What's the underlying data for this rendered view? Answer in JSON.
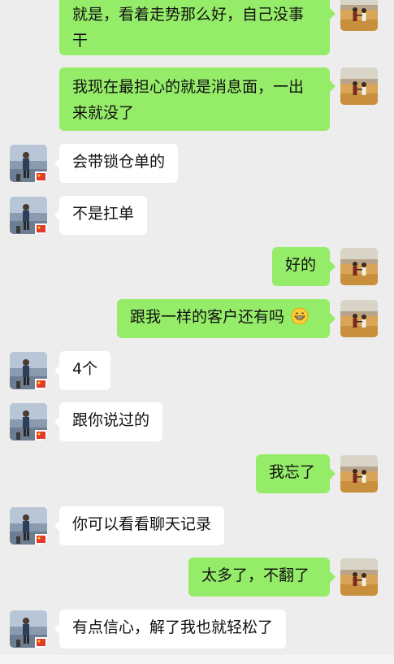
{
  "messages": [
    {
      "side": "right",
      "text": "就是，看着走势那么好，自己没事干"
    },
    {
      "side": "right",
      "text": "我现在最担心的就是消息面，一出来就没了"
    },
    {
      "side": "left",
      "text": "会带锁仓单的"
    },
    {
      "side": "left",
      "text": "不是扛单"
    },
    {
      "side": "right",
      "text": "好的"
    },
    {
      "side": "right",
      "text": "跟我一样的客户还有吗",
      "emoji": "grinning-face-emoji"
    },
    {
      "side": "left",
      "text": "4个"
    },
    {
      "side": "left",
      "text": "跟你说过的"
    },
    {
      "side": "right",
      "text": "我忘了"
    },
    {
      "side": "left",
      "text": "你可以看看聊天记录"
    },
    {
      "side": "right",
      "text": "太多了，不翻了"
    },
    {
      "side": "left",
      "text": "有点信心，解了我也就轻松了"
    }
  ],
  "colors": {
    "background": "#ededed",
    "sent_bubble": "#95ec69",
    "received_bubble": "#ffffff"
  }
}
